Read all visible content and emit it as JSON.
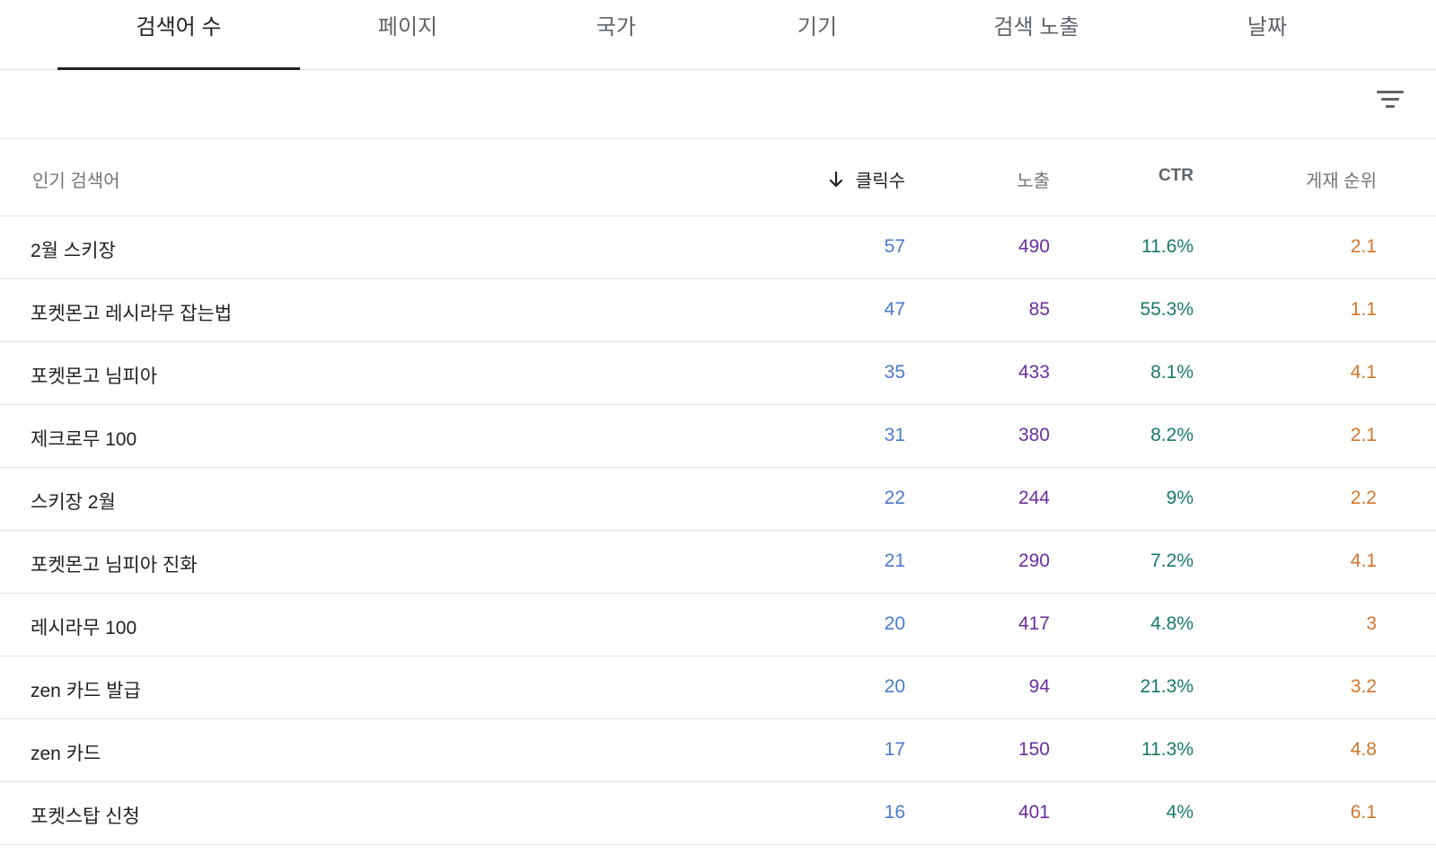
{
  "tabs": [
    {
      "label": "검색어 수",
      "active": true
    },
    {
      "label": "페이지",
      "active": false
    },
    {
      "label": "국가",
      "active": false
    },
    {
      "label": "기기",
      "active": false
    },
    {
      "label": "검색 노출",
      "active": false
    },
    {
      "label": "날짜",
      "active": false
    }
  ],
  "table": {
    "headers": {
      "query": "인기 검색어",
      "clicks": "클릭수",
      "impressions": "노출",
      "ctr": "CTR",
      "position": "게재 순위"
    },
    "sort_column": "clicks",
    "rows": [
      {
        "query": "2월 스키장",
        "clicks": "57",
        "impressions": "490",
        "ctr": "11.6%",
        "position": "2.1"
      },
      {
        "query": "포켓몬고 레시라무 잡는법",
        "clicks": "47",
        "impressions": "85",
        "ctr": "55.3%",
        "position": "1.1"
      },
      {
        "query": "포켓몬고 님피아",
        "clicks": "35",
        "impressions": "433",
        "ctr": "8.1%",
        "position": "4.1"
      },
      {
        "query": "제크로무 100",
        "clicks": "31",
        "impressions": "380",
        "ctr": "8.2%",
        "position": "2.1"
      },
      {
        "query": "스키장 2월",
        "clicks": "22",
        "impressions": "244",
        "ctr": "9%",
        "position": "2.2"
      },
      {
        "query": "포켓몬고 님피아 진화",
        "clicks": "21",
        "impressions": "290",
        "ctr": "7.2%",
        "position": "4.1"
      },
      {
        "query": "레시라무 100",
        "clicks": "20",
        "impressions": "417",
        "ctr": "4.8%",
        "position": "3"
      },
      {
        "query": "zen 카드 발급",
        "clicks": "20",
        "impressions": "94",
        "ctr": "21.3%",
        "position": "3.2"
      },
      {
        "query": "zen 카드",
        "clicks": "17",
        "impressions": "150",
        "ctr": "11.3%",
        "position": "4.8"
      },
      {
        "query": "포켓스탑 신청",
        "clicks": "16",
        "impressions": "401",
        "ctr": "4%",
        "position": "6.1"
      }
    ]
  },
  "icons": {
    "filter": "filter-icon",
    "sort": "arrow-down-icon"
  },
  "colors": {
    "clicks": "#4a7bc8",
    "impressions": "#6a2e9c",
    "ctr": "#187a67",
    "position": "#d2772c"
  }
}
